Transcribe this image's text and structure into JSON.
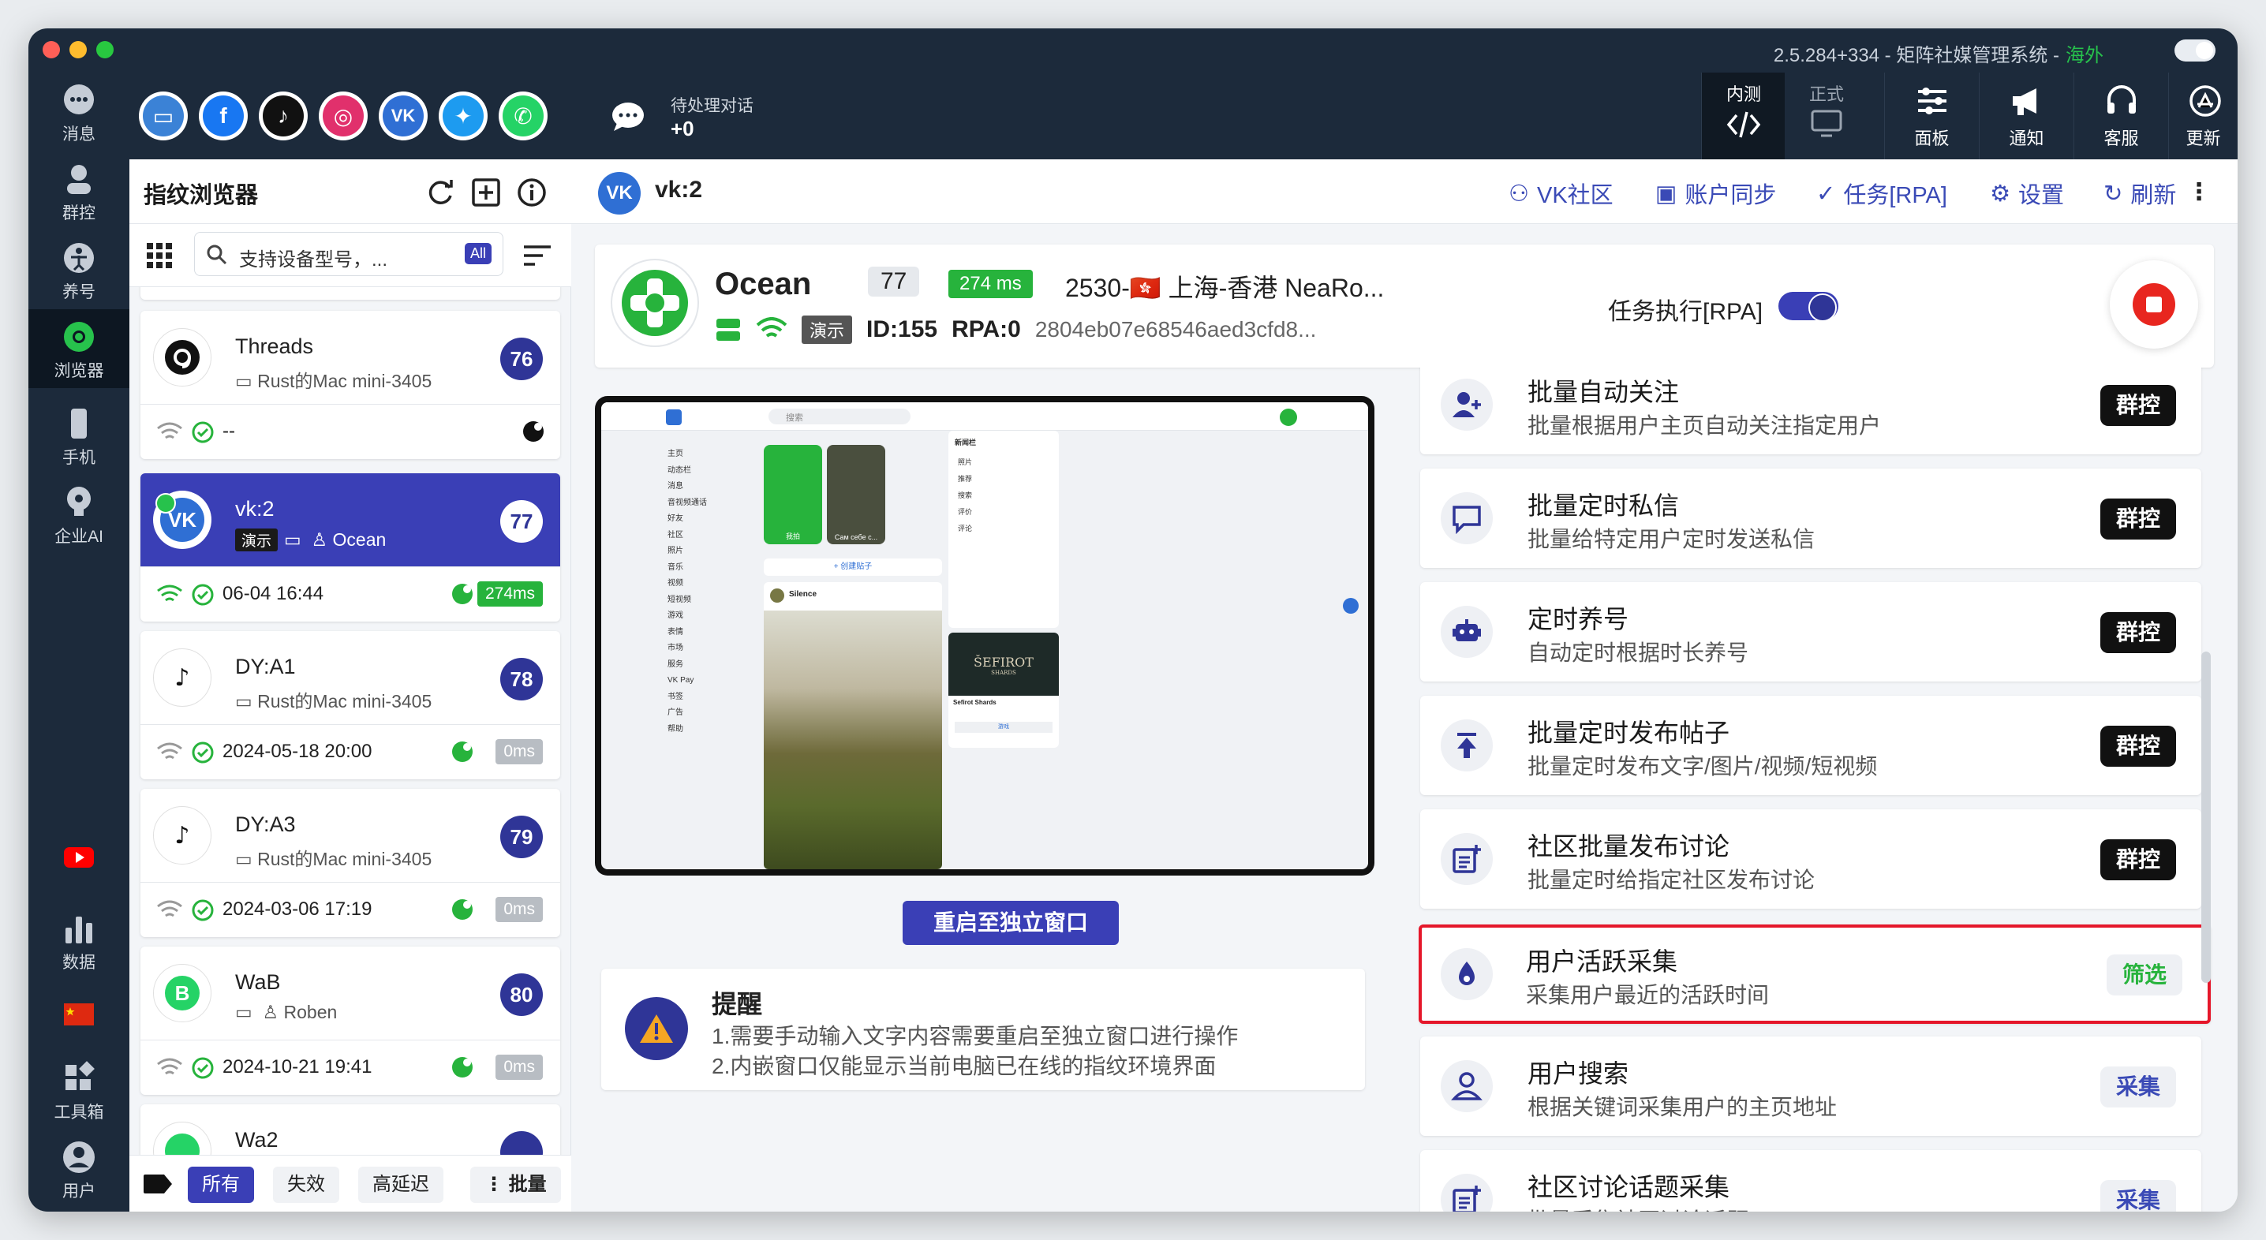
{
  "window": {
    "title": "2.5.284+334 - 矩阵社媒管理系统 -",
    "region": "海外"
  },
  "leftnav": [
    {
      "label": "消息",
      "icon": "message-icon"
    },
    {
      "label": "群控",
      "icon": "group-control-icon"
    },
    {
      "label": "养号",
      "icon": "nurture-icon"
    },
    {
      "label": "浏览器",
      "icon": "browser-icon"
    },
    {
      "label": "手机",
      "icon": "phone-icon"
    },
    {
      "label": "企业AI",
      "icon": "ai-icon"
    },
    {
      "label": "",
      "icon": "youtube-icon"
    },
    {
      "label": "数据",
      "icon": "data-icon"
    },
    {
      "label": "",
      "icon": "china-flag-icon"
    },
    {
      "label": "工具箱",
      "icon": "toolbox-icon"
    },
    {
      "label": "用户",
      "icon": "user-icon"
    }
  ],
  "socials": [
    "laptop",
    "facebook",
    "tiktok",
    "instagram",
    "vk",
    "twitter",
    "whatsapp"
  ],
  "topbar": {
    "pending_label": "待处理对话",
    "pending_value": "+0",
    "inner_test_label": "内测",
    "official_label": "正式",
    "panel_label": "面板",
    "notify_label": "通知",
    "support_label": "客服",
    "update_label": "更新"
  },
  "sidebar": {
    "title": "指纹浏览器",
    "search_placeholder": "支持设备型号，...",
    "search_badge": "All",
    "cards": [
      {
        "name": "Threads",
        "sub": "Rust的Mac mini-3405",
        "num": "76",
        "time": "--",
        "latency": ""
      },
      {
        "name": "vk:2",
        "demo": "演示",
        "sub": "Ocean",
        "num": "77",
        "time": "06-04 16:44",
        "latency": "274ms"
      },
      {
        "name": "DY:A1",
        "sub": "Rust的Mac mini-3405",
        "num": "78",
        "time": "2024-05-18 20:00",
        "latency": "0ms"
      },
      {
        "name": "DY:A3",
        "sub": "Rust的Mac mini-3405",
        "num": "79",
        "time": "2024-03-06 17:19",
        "latency": "0ms"
      },
      {
        "name": "WaB",
        "sub": "Roben",
        "num": "80",
        "time": "2024-10-21 19:41",
        "latency": "0ms"
      },
      {
        "name": "Wa2",
        "sub": "",
        "num": "",
        "time": "",
        "latency": ""
      }
    ],
    "footer": {
      "all": "所有",
      "invalid": "失效",
      "high_latency": "高延迟",
      "batch": "批量"
    }
  },
  "main": {
    "title": "vk:2",
    "links": {
      "community": "VK社区",
      "account_sync": "账户同步",
      "task": "任务[RPA]",
      "settings": "设置",
      "refresh": "刷新"
    },
    "profile": {
      "name": "Ocean",
      "num": "77",
      "ms": "274 ms",
      "location": "2530-🇭🇰 上海-香港 NeaRo...",
      "demo": "演示",
      "id": "ID:155",
      "rpa": "RPA:0",
      "hash": "2804eb07e68546aed3cfd8...",
      "task_label": "任务执行[RPA]"
    },
    "restart_label": "重启至独立窗口",
    "notice": {
      "title": "提醒",
      "line1": "1.需要手动输入文字内容需要重启至独立窗口进行操作",
      "line2": "2.内嵌窗口仅能显示当前电脑已在线的指纹环境界面"
    },
    "tasks": [
      {
        "name": "批量自动关注",
        "desc": "批量根据用户主页自动关注指定用户",
        "btn": "群控"
      },
      {
        "name": "批量定时私信",
        "desc": "批量给特定用户定时发送私信",
        "btn": "群控"
      },
      {
        "name": "定时养号",
        "desc": "自动定时根据时长养号",
        "btn": "群控"
      },
      {
        "name": "批量定时发布帖子",
        "desc": "批量定时发布文字/图片/视频/短视频",
        "btn": "群控"
      },
      {
        "name": "社区批量发布讨论",
        "desc": "批量定时给指定社区发布讨论",
        "btn": "群控"
      },
      {
        "name": "用户活跃采集",
        "desc": "采集用户最近的活跃时间",
        "btn": "筛选"
      },
      {
        "name": "用户搜索",
        "desc": "根据关键词采集用户的主页地址",
        "btn": "采集"
      },
      {
        "name": "社区讨论话题采集",
        "desc": "批量采集社区讨论话题",
        "btn": "采集"
      }
    ]
  },
  "embedded": {
    "search": "搜索",
    "menu": [
      "主页",
      "动态栏",
      "消息",
      "音视频通话",
      "好友",
      "社区",
      "照片",
      "音乐",
      "视频",
      "短视频",
      "游戏",
      "表情",
      "市场",
      "服务",
      "VK Pay",
      "书签",
      "广告",
      "帮助"
    ],
    "new_post": "+ 创建贴子",
    "post_author": "Silence",
    "news_title": "新闻栏",
    "news_items": [
      "照片",
      "推荐",
      "搜索",
      "评价",
      "评论"
    ],
    "ad_title": "ŠEFIROT",
    "ad_subtitle": "SHARDS",
    "ad_name": "Sefirot Shards",
    "ad_button": "游戏",
    "story1": "我拍",
    "story2": "Сам себе с..."
  }
}
